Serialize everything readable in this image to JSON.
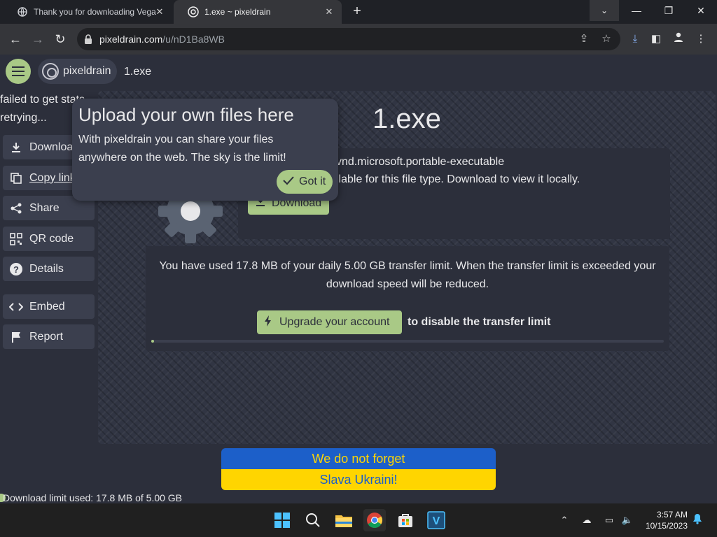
{
  "browser": {
    "tabs": [
      {
        "title": "Thank you for downloading Vega",
        "active": false
      },
      {
        "title": "1.exe ~ pixeldrain",
        "active": true
      }
    ],
    "url_domain": "pixeldrain.com",
    "url_path": "/u/nD1Ba8WB"
  },
  "header": {
    "brand": "pixeldrain",
    "file_name": "1.exe"
  },
  "stats": {
    "line1": "failed to get stats",
    "line2": "retrying..."
  },
  "sidebar": {
    "items": [
      {
        "label": "Download",
        "icon": "download-icon"
      },
      {
        "label": "Copy link",
        "icon": "copy-icon"
      },
      {
        "label": "Share",
        "icon": "share-icon"
      },
      {
        "label": "QR code",
        "icon": "qr-code-icon"
      },
      {
        "label": "Details",
        "icon": "help-icon"
      },
      {
        "label": "Embed",
        "icon": "code-icon"
      },
      {
        "label": "Report",
        "icon": "flag-icon"
      }
    ]
  },
  "viewer": {
    "title": "1.exe",
    "mime": "vnd.microsoft.portable-executable",
    "no_preview": "ilable for this file type. Download to view it locally.",
    "download_label": "Download",
    "limit_line": "You have used 17.8 MB of your daily 5.00 GB transfer limit. When the transfer limit is exceeded your download speed will be reduced.",
    "upgrade_label": "Upgrade your account",
    "upgrade_tail": "to disable the transfer limit",
    "limit_used_fraction": 0.0036
  },
  "popup": {
    "title": "Upload your own files here",
    "body": "With pixeldrain you can share your files anywhere on the web. The sky is the limit!",
    "button": "Got it"
  },
  "banner": {
    "top": "We do not forget",
    "bottom": "Slava Ukraini!"
  },
  "footer": {
    "limit_text": "Download limit used: 17.8 MB of 5.00 GB"
  },
  "taskbar": {
    "time": "3:57 AM",
    "date": "10/15/2023"
  },
  "colors": {
    "accent": "#a9c986",
    "background": "#2c2f3b",
    "panel": "#3b3f4e",
    "ukraine_blue": "#1c5fc9",
    "ukraine_yellow": "#ffd500"
  }
}
